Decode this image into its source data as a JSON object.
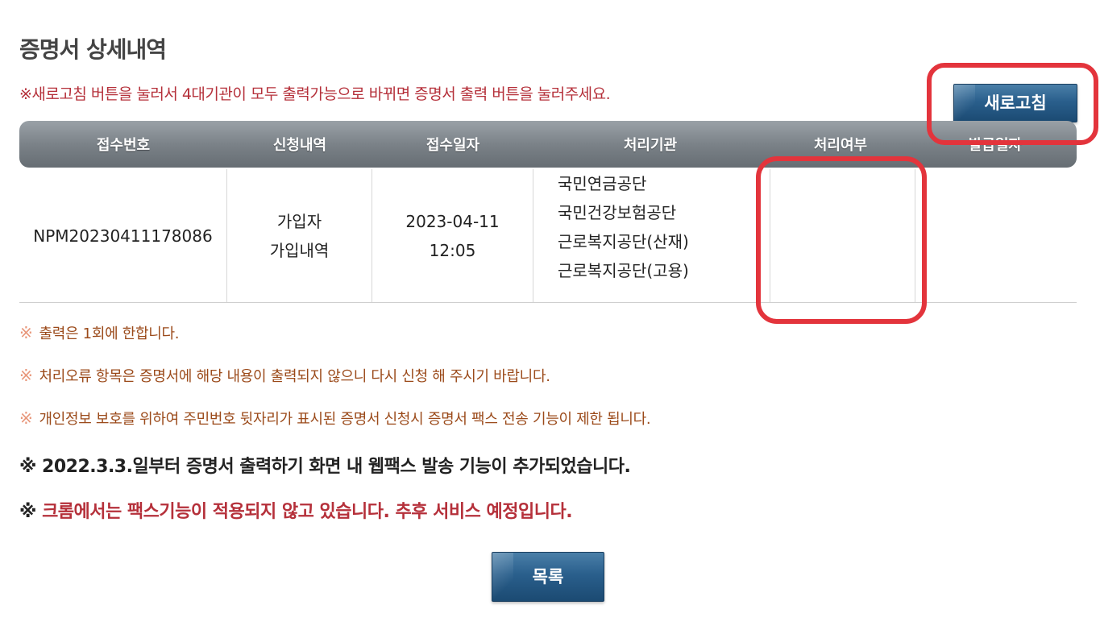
{
  "page": {
    "title": "증명서 상세내역",
    "refresh_notice": "※새로고침 버튼을 눌러서 4대기관이 모두 출력가능으로 바뀌면 증명서 출력 버튼을 눌러주세요.",
    "refresh_button": "새로고침",
    "list_button": "목록"
  },
  "table": {
    "headers": [
      "접수번호",
      "신청내역",
      "접수일자",
      "처리기관",
      "처리여부",
      "발급일자"
    ],
    "row": {
      "receipt_no": "NPM20230411178086",
      "request_line1": "가입자",
      "request_line2": "가입내역",
      "date_line1": "2023-04-11",
      "date_line2": "12:05",
      "agencies": [
        "국민연금공단",
        "국민건강보험공단",
        "근로복지공단(산재)",
        "근로복지공단(고용)"
      ],
      "status": "",
      "issue_date": ""
    }
  },
  "notes": {
    "mark": "※",
    "items": [
      "출력은 1회에 한합니다.",
      "처리오류 항목은 증명서에 해당 내용이 출력되지 않으니 다시 신청 해 주시기 바랍니다.",
      "개인정보 보호를 위하여 주민번호 뒷자리가 표시된 증명서 신청시 증명서 팩스 전송 기능이 제한 됩니다."
    ],
    "webfax": "※ 2022.3.3.일부터 증명서 출력하기 화면 내 웹팩스 발송 기능이 추가되었습니다.",
    "chrome_mark": "※",
    "chrome": "크롬에서는 팩스기능이 적용되지 않고 있습니다. 추후 서비스 예정입니다."
  },
  "colors": {
    "accent_red": "#b5303a",
    "highlight_box": "#e3343c",
    "button_blue": "#2a5f8c",
    "header_gray": "#7b8288"
  }
}
